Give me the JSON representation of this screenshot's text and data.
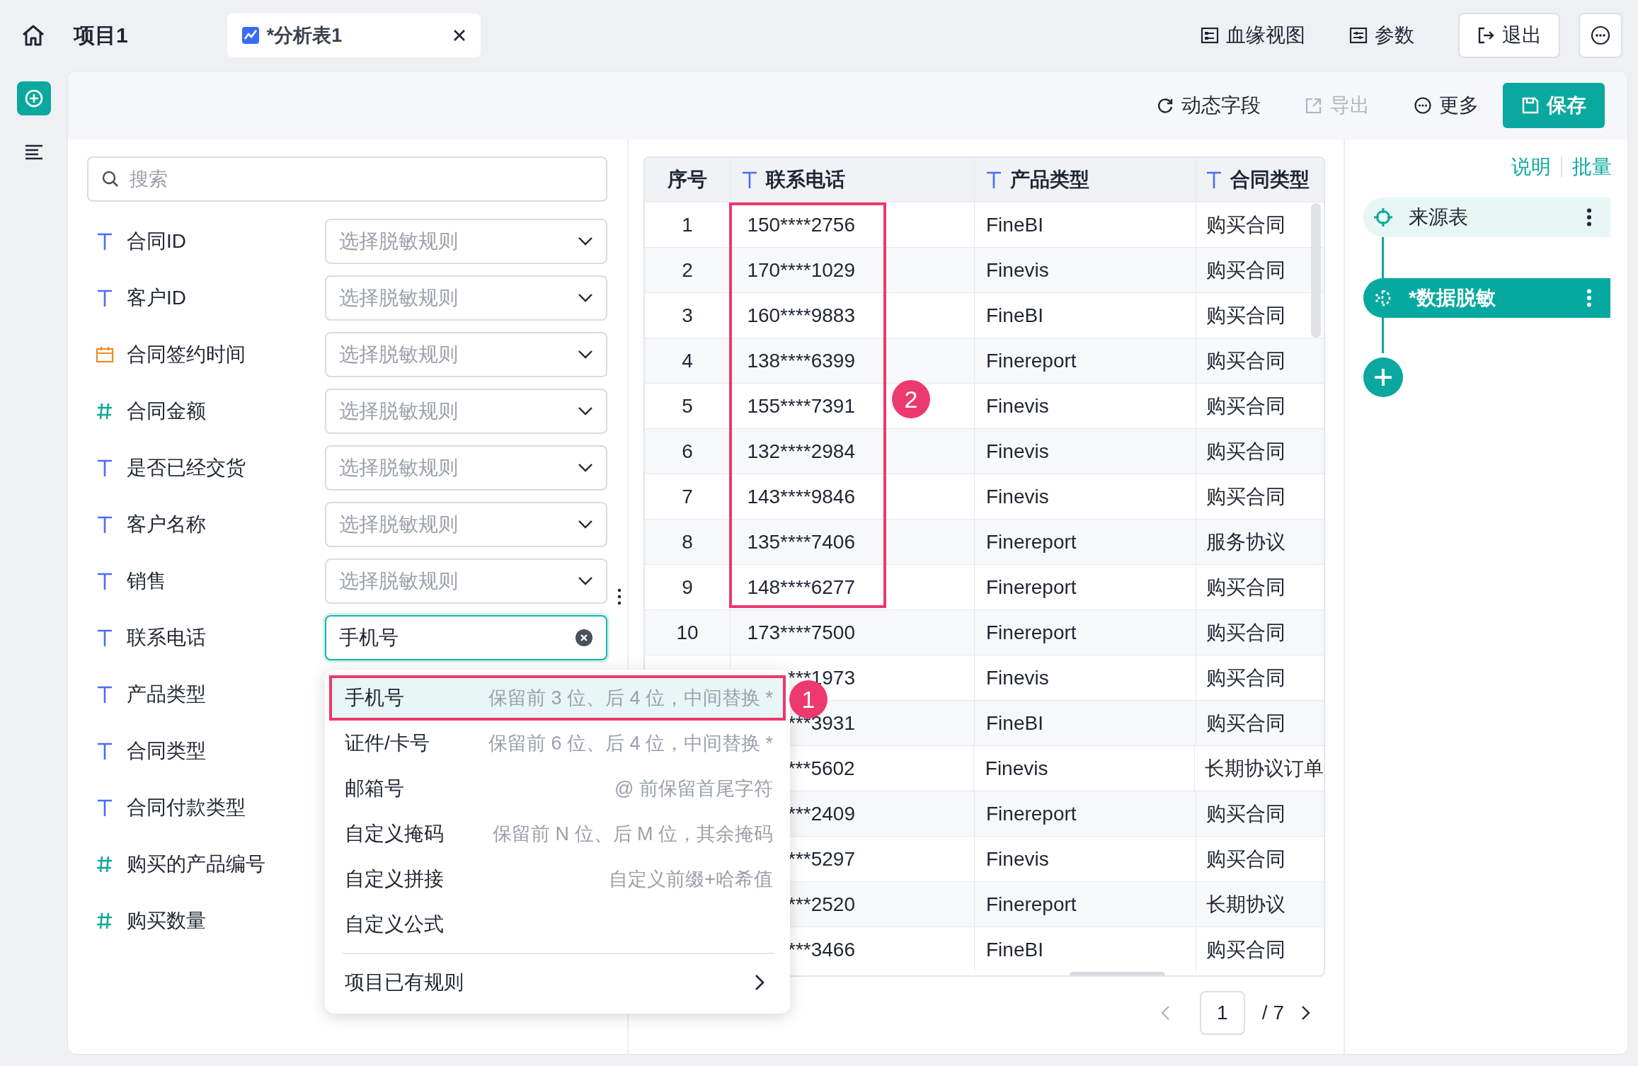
{
  "topbar": {
    "project": "项目1",
    "tab": {
      "title": "*分析表1"
    },
    "actions": [
      {
        "label": "血缘视图",
        "kind": "lineage"
      },
      {
        "label": "参数",
        "kind": "params"
      },
      {
        "label": "退出",
        "kind": "exit"
      }
    ]
  },
  "toolbar": {
    "actions": [
      {
        "label": "动态字段",
        "kind": "dynamic",
        "disabled": false
      },
      {
        "label": "导出",
        "kind": "export",
        "disabled": true
      },
      {
        "label": "更多",
        "kind": "more",
        "disabled": false
      }
    ],
    "save": {
      "label": "保存"
    }
  },
  "search": {
    "placeholder": "搜索"
  },
  "fields": [
    {
      "name": "合同ID",
      "kind": "text",
      "rule": {
        "placeholder": "选择脱敏规则"
      }
    },
    {
      "name": "客户ID",
      "kind": "text",
      "rule": {
        "placeholder": "选择脱敏规则"
      }
    },
    {
      "name": "合同签约时间",
      "kind": "date",
      "rule": {
        "placeholder": "选择脱敏规则"
      }
    },
    {
      "name": "合同金额",
      "kind": "number",
      "rule": {
        "placeholder": "选择脱敏规则"
      }
    },
    {
      "name": "是否已经交货",
      "kind": "text",
      "rule": {
        "placeholder": "选择脱敏规则"
      }
    },
    {
      "name": "客户名称",
      "kind": "text",
      "rule": {
        "placeholder": "选择脱敏规则"
      }
    },
    {
      "name": "销售",
      "kind": "text",
      "rule": {
        "placeholder": "选择脱敏规则"
      }
    },
    {
      "name": "联系电话",
      "kind": "text",
      "rule": {
        "value": "手机号",
        "focused": true
      }
    },
    {
      "name": "产品类型",
      "kind": "text"
    },
    {
      "name": "合同类型",
      "kind": "text"
    },
    {
      "name": "合同付款类型",
      "kind": "text"
    },
    {
      "name": "购买的产品编号",
      "kind": "number"
    },
    {
      "name": "购买数量",
      "kind": "number"
    }
  ],
  "dropdown": {
    "options": [
      {
        "label": "手机号",
        "hint": "保留前 3 位、后 4 位，中间替换 *",
        "selected": true
      },
      {
        "label": "证件/卡号",
        "hint": "保留前 6 位、后 4 位，中间替换 *",
        "selected": false
      },
      {
        "label": "邮箱号",
        "hint": "@ 前保留首尾字符",
        "selected": false
      },
      {
        "label": "自定义掩码",
        "hint": "保留前 N 位、后 M 位，其余掩码",
        "selected": false
      },
      {
        "label": "自定义拼接",
        "hint": "自定义前缀+哈希值",
        "selected": false
      },
      {
        "label": "自定义公式",
        "selected": false
      }
    ],
    "submenu": {
      "label": "项目已有规则"
    }
  },
  "callouts": [
    {
      "number": "1"
    },
    {
      "number": "2"
    }
  ],
  "table": {
    "columns": [
      {
        "label": "序号"
      },
      {
        "label": "联系电话",
        "kind": "text"
      },
      {
        "label": "产品类型",
        "kind": "text"
      },
      {
        "label": "合同类型",
        "kind": "text"
      }
    ],
    "rows": [
      {
        "index": "1",
        "phone": "150****2756",
        "product": "FineBI",
        "contract": "购买合同"
      },
      {
        "index": "2",
        "phone": "170****1029",
        "product": "Finevis",
        "contract": "购买合同"
      },
      {
        "index": "3",
        "phone": "160****9883",
        "product": "FineBI",
        "contract": "购买合同"
      },
      {
        "index": "4",
        "phone": "138****6399",
        "product": "Finereport",
        "contract": "购买合同"
      },
      {
        "index": "5",
        "phone": "155****7391",
        "product": "Finevis",
        "contract": "购买合同"
      },
      {
        "index": "6",
        "phone": "132****2984",
        "product": "Finevis",
        "contract": "购买合同"
      },
      {
        "index": "7",
        "phone": "143****9846",
        "product": "Finevis",
        "contract": "购买合同"
      },
      {
        "index": "8",
        "phone": "135****7406",
        "product": "Finereport",
        "contract": "服务协议"
      },
      {
        "index": "9",
        "phone": "148****6277",
        "product": "Finereport",
        "contract": "购买合同"
      },
      {
        "index": "10",
        "phone": "173****7500",
        "product": "Finereport",
        "contract": "购买合同"
      },
      {
        "phone": "***1973",
        "product": "Finevis",
        "contract": "购买合同"
      },
      {
        "phone": "***3931",
        "product": "FineBI",
        "contract": "购买合同"
      },
      {
        "phone": "***5602",
        "product": "Finevis",
        "contract": "长期协议订单"
      },
      {
        "phone": "***2409",
        "product": "Finereport",
        "contract": "购买合同"
      },
      {
        "phone": "***5297",
        "product": "Finevis",
        "contract": "购买合同"
      },
      {
        "phone": "***2520",
        "product": "Finereport",
        "contract": "长期协议"
      },
      {
        "phone": "***3466",
        "product": "FineBI",
        "contract": "购买合同"
      }
    ]
  },
  "pagination": {
    "current": "1",
    "total": "/ 7"
  },
  "right_panel": {
    "links": [
      {
        "label": "说明"
      },
      {
        "label": "批量"
      }
    ],
    "steps": [
      {
        "label": "来源表",
        "kind": "source",
        "selected": false
      },
      {
        "label": "*数据脱敏",
        "kind": "mask",
        "selected": true
      }
    ]
  }
}
